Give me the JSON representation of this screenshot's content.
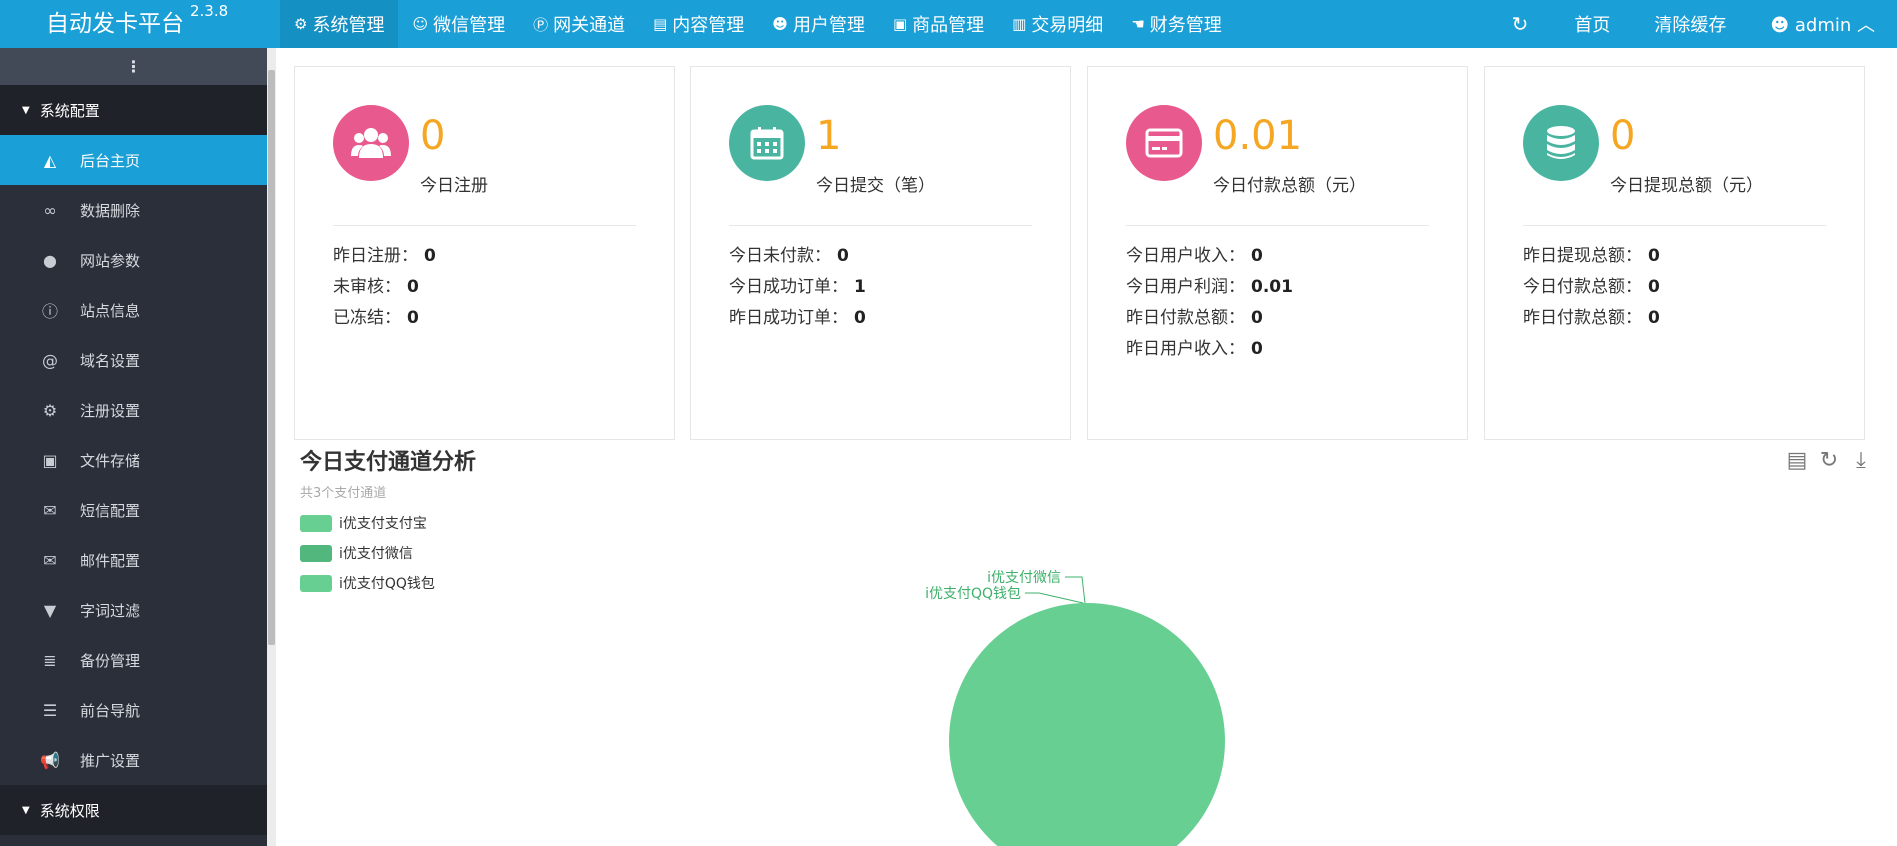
{
  "app": {
    "title": "自动发卡平台",
    "version": "2.3.8"
  },
  "topnav": [
    {
      "label": "系统管理",
      "icon": "gear-icon",
      "glyph": "⚙"
    },
    {
      "label": "微信管理",
      "icon": "wechat-icon",
      "glyph": "☺"
    },
    {
      "label": "网关通道",
      "icon": "paypal-icon",
      "glyph": "Ⓟ"
    },
    {
      "label": "内容管理",
      "icon": "file-icon",
      "glyph": "▤"
    },
    {
      "label": "用户管理",
      "icon": "users-icon",
      "glyph": "☻"
    },
    {
      "label": "商品管理",
      "icon": "shopping-bag-icon",
      "glyph": "▣"
    },
    {
      "label": "交易明细",
      "icon": "bar-chart-icon",
      "glyph": "▥"
    },
    {
      "label": "财务管理",
      "icon": "hand-icon",
      "glyph": "☚"
    }
  ],
  "rightnav": {
    "refresh_glyph": "↻",
    "home": "首页",
    "clear_cache": "清除缓存",
    "user": "admin",
    "user_glyph": "☻",
    "caret": "︿"
  },
  "sidebar": {
    "toggle_glyph": "⋮",
    "group1": "系统配置",
    "group2": "系统权限",
    "caret": "▼",
    "items": [
      {
        "label": "后台主页",
        "icon": "area-chart-icon",
        "glyph": "◭"
      },
      {
        "label": "数据删除",
        "icon": "link-icon",
        "glyph": "∞"
      },
      {
        "label": "网站参数",
        "icon": "apple-icon",
        "glyph": "●"
      },
      {
        "label": "站点信息",
        "icon": "info-icon",
        "glyph": "ⓘ"
      },
      {
        "label": "域名设置",
        "icon": "at-icon",
        "glyph": "@"
      },
      {
        "label": "注册设置",
        "icon": "gear-icon",
        "glyph": "⚙"
      },
      {
        "label": "文件存储",
        "icon": "save-icon",
        "glyph": "▣"
      },
      {
        "label": "短信配置",
        "icon": "envelope-icon",
        "glyph": "✉"
      },
      {
        "label": "邮件配置",
        "icon": "envelope-icon",
        "glyph": "✉"
      },
      {
        "label": "字词过滤",
        "icon": "filter-icon",
        "glyph": "▼"
      },
      {
        "label": "备份管理",
        "icon": "database-icon",
        "glyph": "≣"
      },
      {
        "label": "前台导航",
        "icon": "bars-icon",
        "glyph": "☰"
      },
      {
        "label": "推广设置",
        "icon": "bullhorn-icon",
        "glyph": "📢"
      }
    ]
  },
  "cards": [
    {
      "value": "0",
      "caption": "今日注册",
      "icon": "users-icon",
      "color": "#e8598d",
      "lines": [
        {
          "label": "昨日注册：",
          "value": "0"
        },
        {
          "label": "未审核：",
          "value": "0"
        },
        {
          "label": "已冻结：",
          "value": "0"
        }
      ]
    },
    {
      "value": "1",
      "caption": "今日提交（笔）",
      "icon": "calendar-icon",
      "color": "#49b5a0",
      "lines": [
        {
          "label": "今日未付款：",
          "value": "0"
        },
        {
          "label": "今日成功订单：",
          "value": "1"
        },
        {
          "label": "昨日成功订单：",
          "value": "0"
        }
      ]
    },
    {
      "value": "0.01",
      "caption": "今日付款总额（元）",
      "icon": "credit-card-icon",
      "color": "#e8598d",
      "lines": [
        {
          "label": "今日用户收入：",
          "value": "0"
        },
        {
          "label": "今日用户利润：",
          "value": "0.01"
        },
        {
          "label": "昨日付款总额：",
          "value": "0"
        },
        {
          "label": "昨日用户收入：",
          "value": "0"
        }
      ]
    },
    {
      "value": "0",
      "caption": "今日提现总额（元）",
      "icon": "database-icon",
      "color": "#49b5a0",
      "lines": [
        {
          "label": "昨日提现总额：",
          "value": "0"
        },
        {
          "label": "今日付款总额：",
          "value": "0"
        },
        {
          "label": "昨日付款总额：",
          "value": "0"
        }
      ]
    }
  ],
  "chart": {
    "title": "今日支付通道分析",
    "subtitle": "共3个支付通道",
    "tools": [
      {
        "icon": "data-view-icon",
        "glyph": "▤"
      },
      {
        "icon": "restore-icon",
        "glyph": "↻"
      },
      {
        "icon": "download-icon",
        "glyph": "⤓"
      }
    ]
  },
  "chart_data": {
    "type": "pie",
    "categories": [
      "i优支付支付宝",
      "i优支付微信",
      "i优支付QQ钱包"
    ],
    "values": [
      1,
      0,
      0
    ],
    "colors": [
      "#66cf91",
      "#52b77c",
      "#66cf91"
    ],
    "title": "今日支付通道分析",
    "subtitle": "共3个支付通道",
    "legend": "top-left",
    "visible_labels": [
      "i优支付微信",
      "i优支付QQ钱包"
    ],
    "label_color": "#3db06a"
  }
}
